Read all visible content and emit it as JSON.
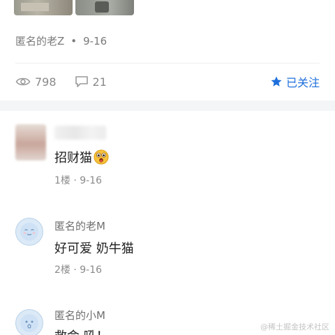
{
  "post": {
    "author": "匿名的老Z",
    "separator": "•",
    "date": "9-16",
    "views": "798",
    "comments": "21",
    "follow_label": "已关注",
    "accent": "#1e6fdb"
  },
  "comments": [
    {
      "text": "招财猫",
      "floor": "1楼 · 9-16"
    },
    {
      "author": "匿名的老M",
      "text": "好可爱 奶牛猫",
      "floor": "2楼 · 9-16"
    },
    {
      "author": "匿名的小M",
      "text": "救命 吼！"
    }
  ],
  "watermark": "@稀土掘金技术社区"
}
